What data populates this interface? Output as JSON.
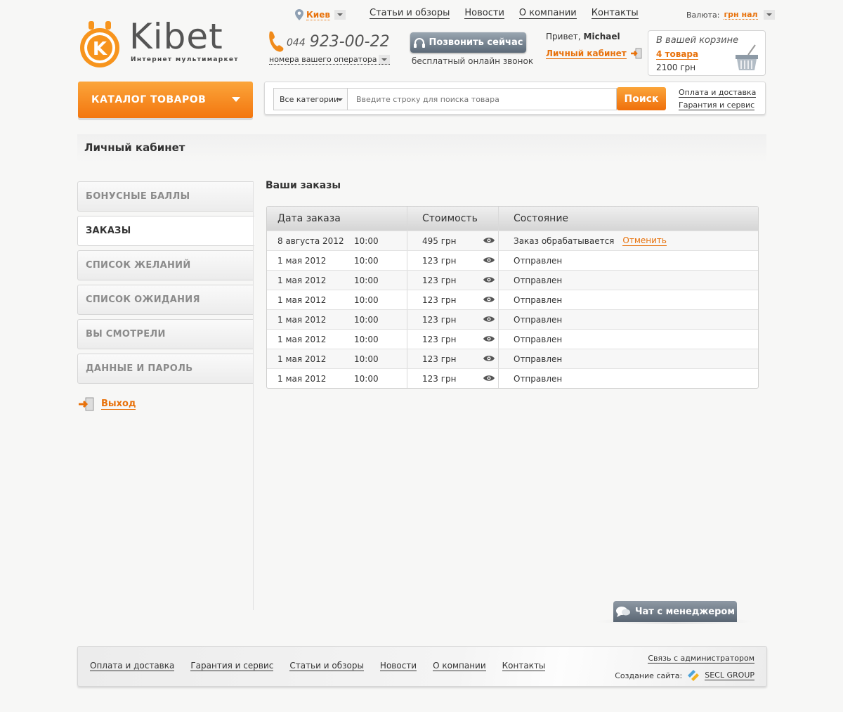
{
  "brand": {
    "name": "Kibet",
    "tagline": "Интернет мультимаркет"
  },
  "header": {
    "city": "Киев",
    "nav": [
      "Статьи и обзоры",
      "Новости",
      "О компании",
      "Контакты"
    ],
    "currency_label": "Валюта:",
    "currency_value": "грн нал",
    "phone_code": "044",
    "phone_number": "923-00-22",
    "operators": "номера вашего оператора",
    "call_button": "Позвонить сейчас",
    "call_sub": "бесплатный онлайн звонок",
    "greeting": "Привет,",
    "user_name": "Michael",
    "cabinet_link": "Личный кабинет",
    "cart": {
      "title": "В вашей корзине",
      "count": "4 товара",
      "sum": "2100 грн"
    }
  },
  "catalog_button": "КАТАЛОГ ТОВАРОВ",
  "search": {
    "category": "Все категории",
    "placeholder": "Введите строку для поиска товара",
    "button": "Поиск",
    "links": [
      "Оплата и доставка",
      "Гарантия и сервис"
    ]
  },
  "page_title": "Личный кабинет",
  "sidebar": {
    "items": [
      {
        "label": "БОНУСНЫЕ БАЛЛЫ",
        "active": false
      },
      {
        "label": "ЗАКАЗЫ",
        "active": true
      },
      {
        "label": "СПИСОК ЖЕЛАНИЙ",
        "active": false
      },
      {
        "label": "СПИСОК ОЖИДАНИЯ",
        "active": false
      },
      {
        "label": "ВЫ СМОТРЕЛИ",
        "active": false
      },
      {
        "label": "ДАННЫЕ И ПАРОЛЬ",
        "active": false
      }
    ],
    "logout": "Выход"
  },
  "orders": {
    "title": "Ваши заказы",
    "columns": [
      "Дата заказа",
      "Стоимость",
      "Состояние"
    ],
    "rows": [
      {
        "date": "8 августа 2012",
        "time": "10:00",
        "price": "495 грн",
        "status": "Заказ обрабатывается",
        "action": "Отменить"
      },
      {
        "date": "1 мая 2012",
        "time": "10:00",
        "price": "123 грн",
        "status": "Отправлен",
        "action": ""
      },
      {
        "date": "1 мая 2012",
        "time": "10:00",
        "price": "123 грн",
        "status": "Отправлен",
        "action": ""
      },
      {
        "date": "1 мая 2012",
        "time": "10:00",
        "price": "123 грн",
        "status": "Отправлен",
        "action": ""
      },
      {
        "date": "1 мая 2012",
        "time": "10:00",
        "price": "123 грн",
        "status": "Отправлен",
        "action": ""
      },
      {
        "date": "1 мая 2012",
        "time": "10:00",
        "price": "123 грн",
        "status": "Отправлен",
        "action": ""
      },
      {
        "date": "1 мая 2012",
        "time": "10:00",
        "price": "123 грн",
        "status": "Отправлен",
        "action": ""
      },
      {
        "date": "1 мая 2012",
        "time": "10:00",
        "price": "123 грн",
        "status": "Отправлен",
        "action": ""
      }
    ]
  },
  "chat_button": "Чат с менеджером",
  "footer": {
    "nav": [
      "Оплата и доставка",
      "Гарантия и сервис",
      "Статьи и обзоры",
      "Новости",
      "О компании",
      "Контакты"
    ],
    "admin_link": "Связь с администратором",
    "made_by_label": "Создание сайта:",
    "made_by": "SECL GROUP"
  },
  "colors": {
    "accent": "#f3760f",
    "link_orange": "#e8720c",
    "button_grey": "#5c6a78"
  }
}
